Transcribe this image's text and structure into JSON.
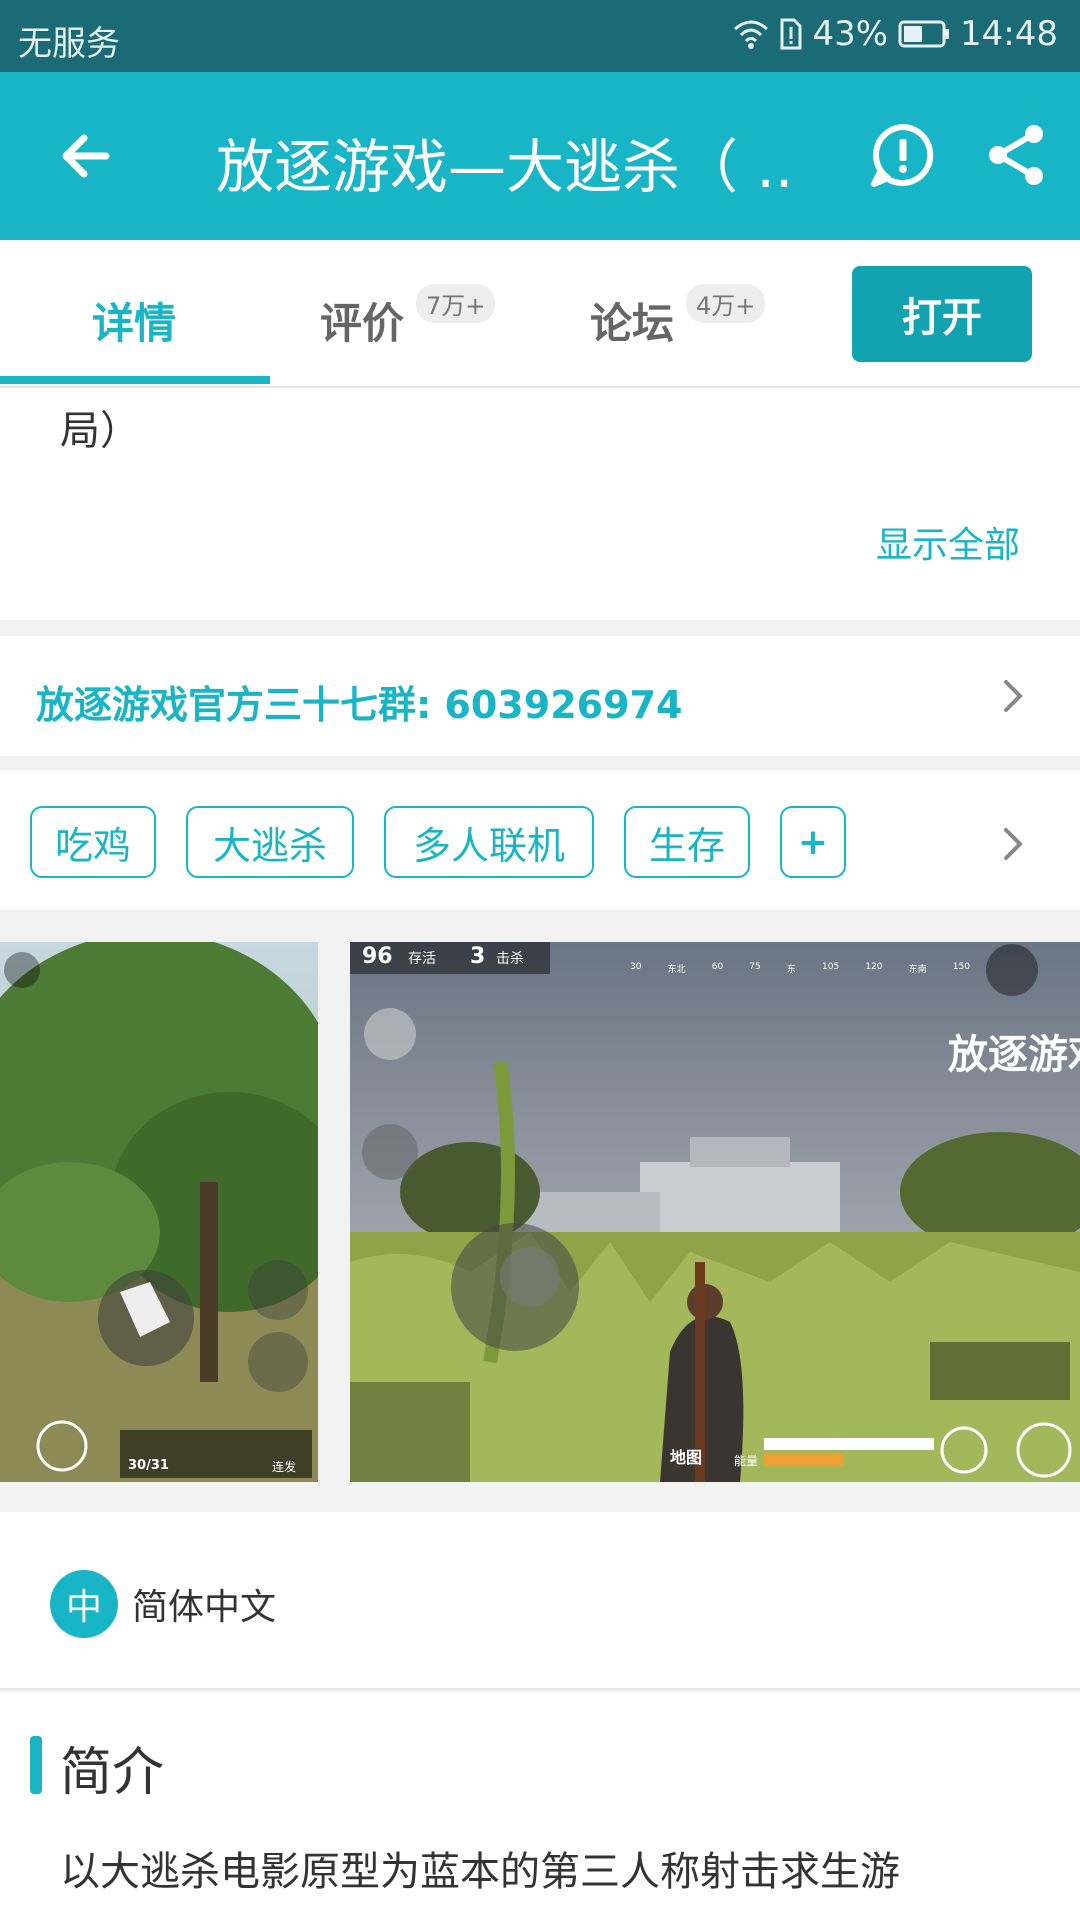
{
  "status_bar": {
    "carrier": "无服务",
    "battery": "43%",
    "time": "14:48"
  },
  "app_bar": {
    "title": "放逐游戏—大逃杀（ ..."
  },
  "tabs": [
    {
      "label": "详情",
      "badge": ""
    },
    {
      "label": "评价",
      "badge": "7万+"
    },
    {
      "label": "论坛",
      "badge": "4万+"
    }
  ],
  "open_button": "打开",
  "description_tail": "局）",
  "show_all": "显示全部",
  "group_info": "放逐游戏官方三十七群: 603926974",
  "tags": [
    "吃鸡",
    "大逃杀",
    "多人联机",
    "生存",
    "+"
  ],
  "screenshot2": {
    "alive_count": "96",
    "alive_label": "存活",
    "kill_count": "3",
    "kill_label": "击杀",
    "compass": [
      "30",
      "东北",
      "60",
      "75",
      "东",
      "105",
      "120",
      "东南",
      "150"
    ],
    "watermark": "放逐游戏",
    "map_label": "地图",
    "energy_label": "能量"
  },
  "screenshot1": {
    "ammo": "30/31",
    "fire_mode": "连发"
  },
  "language": {
    "icon_char": "中",
    "label": "简体中文"
  },
  "intro": {
    "heading": "简介",
    "body": "以大逃杀电影原型为蓝本的第三人称射击求生游"
  },
  "colors": {
    "accent": "#17b5c6",
    "status_bar": "#1a6b75",
    "button": "#13a2b0"
  }
}
